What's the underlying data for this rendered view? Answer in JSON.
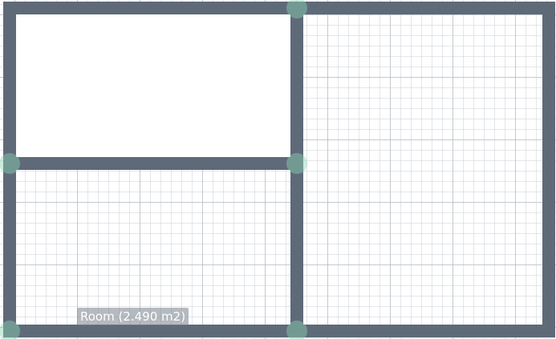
{
  "canvas": {
    "grid_visible": true,
    "wall_color": "#5f6a78",
    "node_color": "#8cd2b4"
  },
  "rooms": [
    {
      "name": "room-top-left",
      "label": ""
    },
    {
      "name": "room-bottom-left",
      "label": "Room (2.490 m2)"
    },
    {
      "name": "room-right",
      "label": ""
    }
  ]
}
